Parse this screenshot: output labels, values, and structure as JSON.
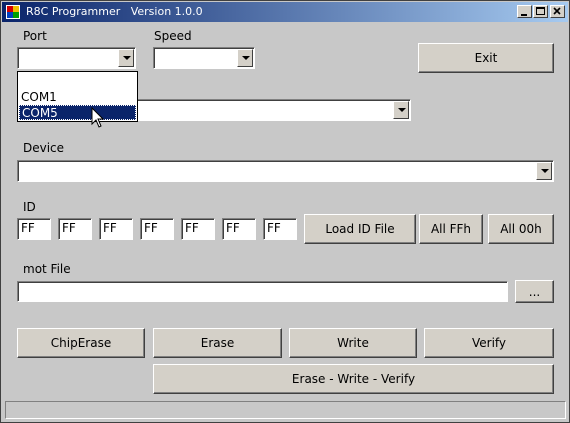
{
  "window": {
    "title": "R8C Programmer   Version 1.0.0"
  },
  "port": {
    "label": "Port",
    "value": "",
    "options": [
      "COM1",
      "COM5"
    ],
    "highlighted_option": "COM5"
  },
  "speed": {
    "label": "Speed",
    "value": ""
  },
  "exit_label": "Exit",
  "series": {
    "value": ""
  },
  "device": {
    "label": "Device",
    "value": ""
  },
  "id": {
    "label": "ID",
    "values": [
      "FF",
      "FF",
      "FF",
      "FF",
      "FF",
      "FF",
      "FF"
    ],
    "load_label": "Load ID File",
    "all_ffh_label": "All FFh",
    "all_00h_label": "All 00h"
  },
  "mot_file": {
    "label": "mot File",
    "value": "",
    "browse_label": "..."
  },
  "actions": {
    "chip_erase": "ChipErase",
    "erase": "Erase",
    "write": "Write",
    "verify": "Verify",
    "erase_write_verify": "Erase - Write - Verify"
  },
  "status": {
    "text": ""
  },
  "colors": {
    "title_start": "#0a246a",
    "title_end": "#a6caf0",
    "selection": "#0a246a",
    "window_bg": "#c8c8c8"
  },
  "icons": [
    "app-icon",
    "minimize-icon",
    "maximize-icon",
    "close-icon",
    "chevron-down-icon",
    "mouse-cursor-icon"
  ]
}
